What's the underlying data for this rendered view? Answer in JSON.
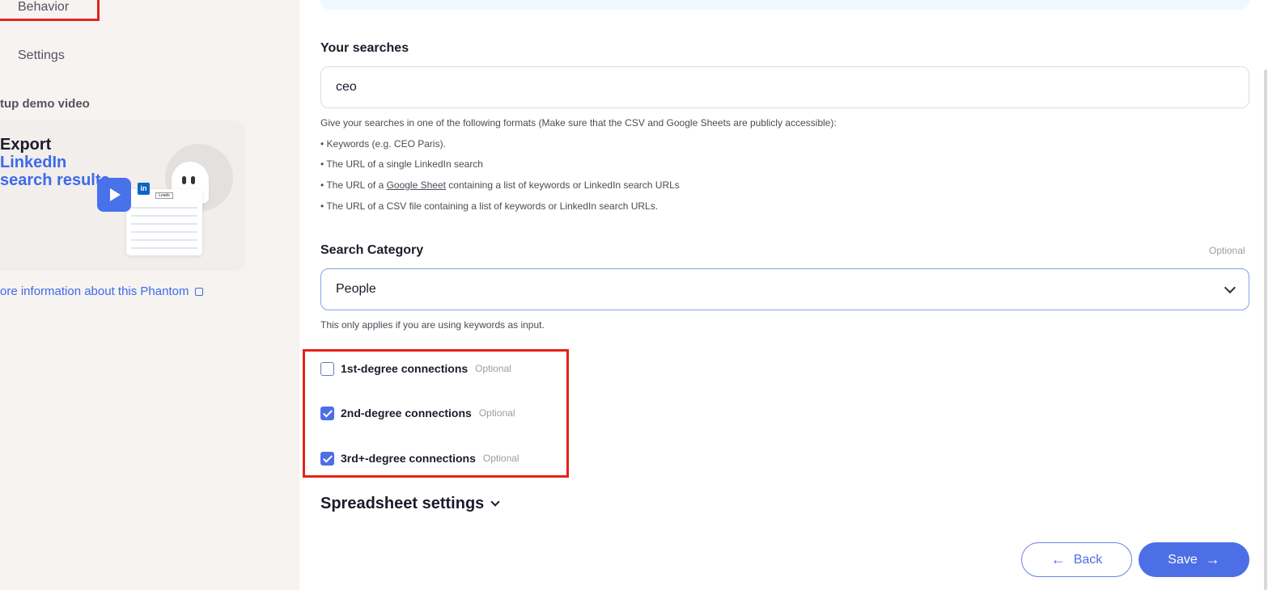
{
  "sidebar": {
    "nav": {
      "behavior": "Behavior",
      "settings": "Settings"
    },
    "demo_title": "tup demo video",
    "card": {
      "line1": "Export",
      "line2": "LinkedIn",
      "line3": "search results",
      "sheet_tag": "Leads",
      "badge": "in"
    },
    "more_info": "ore information about this Phantom"
  },
  "searches": {
    "label": "Your searches",
    "value": "ceo",
    "help": {
      "intro": "Give your searches in one of the following formats (Make sure that the CSV and Google Sheets are publicly accessible):",
      "b1": "• Keywords (e.g. CEO Paris).",
      "b2": "• The URL of a single LinkedIn search",
      "b3_pre": "• The URL of a ",
      "b3_link": "Google Sheet",
      "b3_post": " containing a list of keywords or LinkedIn search URLs",
      "b4": "• The URL of a CSV file containing a list of keywords or LinkedIn search URLs."
    }
  },
  "category": {
    "label": "Search Category",
    "optional": "Optional",
    "selected": "People",
    "help": "This only applies if you are using keywords as input."
  },
  "connections": [
    {
      "label": "1st-degree connections",
      "optional": "Optional",
      "checked": false
    },
    {
      "label": "2nd-degree connections",
      "optional": "Optional",
      "checked": true
    },
    {
      "label": "3rd+-degree connections",
      "optional": "Optional",
      "checked": true
    }
  ],
  "spreadsheet_settings": "Spreadsheet settings",
  "buttons": {
    "back": "Back",
    "save": "Save"
  },
  "icons": {
    "back": "←",
    "save": "→"
  },
  "colors": {
    "accent": "#4d6fe6",
    "highlight": "#e5231b",
    "link": "#3d6ae8"
  }
}
